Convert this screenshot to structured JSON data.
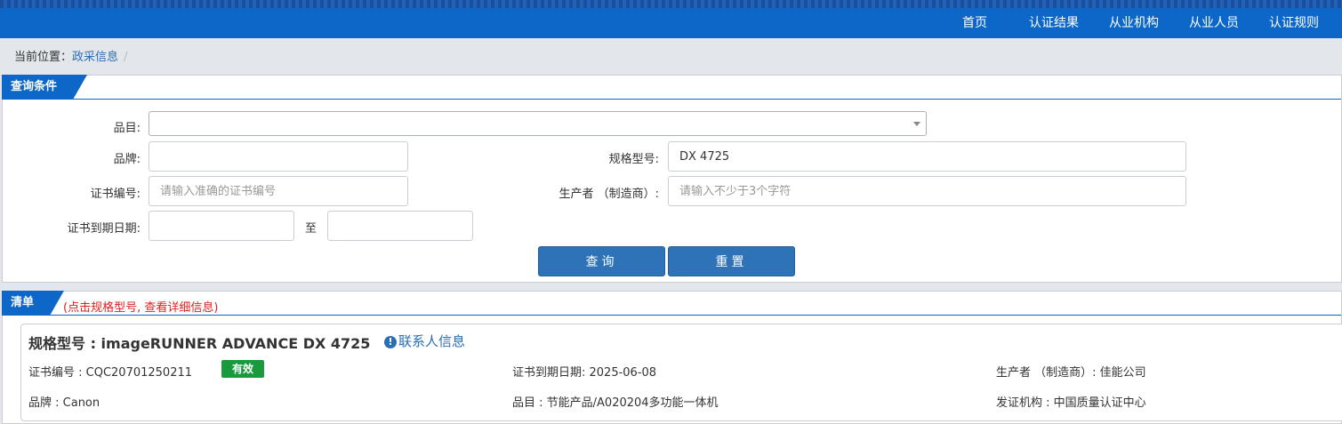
{
  "nav": {
    "items": [
      "首页",
      "认证结果",
      "从业机构",
      "从业人员",
      "认证规则"
    ]
  },
  "breadcrumb": {
    "prefix": "当前位置：",
    "current": "政采信息",
    "separator": "/"
  },
  "query": {
    "tag": "查询条件",
    "category_label": "品目:",
    "category_value": "",
    "brand_label": "品牌:",
    "brand_value": "",
    "model_label": "规格型号:",
    "model_value": "DX 4725",
    "cert_no_label": "证书编号:",
    "cert_no_placeholder": "请输入准确的证书编号",
    "maker_label": "生产者 （制造商）:",
    "maker_placeholder": "请输入不少于3个字符",
    "expiry_label": "证书到期日期:",
    "expiry_from": "",
    "expiry_to": "",
    "to_label": "至",
    "search_button": "查询",
    "reset_button": "重置"
  },
  "list": {
    "tag": "清单",
    "hint": "(点击规格型号, 查看详细信息)",
    "results": [
      {
        "title": "规格型号 : imageRUNNER ADVANCE DX 4725",
        "contact_icon": "info-circle-icon",
        "contact_label": "联系人信息",
        "cert_no": "证书编号 : CQC20701250211",
        "status": "有效",
        "expiry": "证书到期日期: 2025-06-08",
        "maker": "生产者 （制造商）: 佳能公司",
        "brand": "品牌 : Canon",
        "category": "品目 : 节能产品/A020204多功能一体机",
        "issuer": "发证机构 : 中国质量认证中心"
      }
    ]
  },
  "colors": {
    "primary": "#0c67c8",
    "button": "#2e72b8",
    "valid_badge": "#1a9a3c",
    "hint_red": "#e02020",
    "link": "#2a6fb5"
  }
}
